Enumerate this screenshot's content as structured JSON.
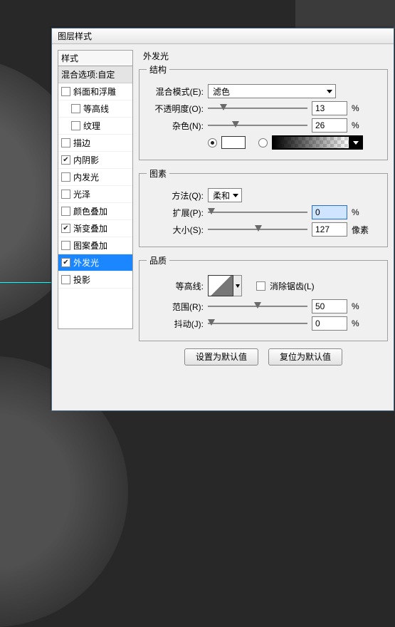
{
  "dialog": {
    "title": "图层样式"
  },
  "styles": {
    "header": "样式",
    "blend": "混合选项:自定",
    "items": [
      {
        "label": "斜面和浮雕",
        "checked": false,
        "indent": 0
      },
      {
        "label": "等高线",
        "checked": false,
        "indent": 1
      },
      {
        "label": "纹理",
        "checked": false,
        "indent": 1
      },
      {
        "label": "描边",
        "checked": false,
        "indent": 0
      },
      {
        "label": "内阴影",
        "checked": true,
        "indent": 0
      },
      {
        "label": "内发光",
        "checked": false,
        "indent": 0
      },
      {
        "label": "光泽",
        "checked": false,
        "indent": 0
      },
      {
        "label": "颜色叠加",
        "checked": false,
        "indent": 0
      },
      {
        "label": "渐变叠加",
        "checked": true,
        "indent": 0
      },
      {
        "label": "图案叠加",
        "checked": false,
        "indent": 0
      },
      {
        "label": "外发光",
        "checked": true,
        "indent": 0,
        "selected": true
      },
      {
        "label": "投影",
        "checked": false,
        "indent": 0
      }
    ]
  },
  "panel": {
    "title": "外发光",
    "struct": {
      "legend": "结构",
      "blend_label": "混合模式(E):",
      "blend_value": "滤色",
      "opacity_label": "不透明度(O):",
      "opacity_value": "13",
      "noise_label": "杂色(N):",
      "noise_value": "26",
      "percent": "%"
    },
    "elements": {
      "legend": "图素",
      "method_label": "方法(Q):",
      "method_value": "柔和",
      "spread_label": "扩展(P):",
      "spread_value": "0",
      "size_label": "大小(S):",
      "size_value": "127",
      "px": "像素",
      "percent": "%"
    },
    "quality": {
      "legend": "品质",
      "contour_label": "等高线:",
      "antialias_label": "消除锯齿(L)",
      "range_label": "范围(R):",
      "range_value": "50",
      "jitter_label": "抖动(J):",
      "jitter_value": "0",
      "percent": "%"
    },
    "buttons": {
      "default": "设置为默认值",
      "reset": "复位为默认值"
    }
  },
  "sliders": {
    "opacity_pct": 13,
    "noise_pct": 26,
    "spread_pct": 0,
    "size_pct": 51,
    "range_pct": 50,
    "jitter_pct": 0
  }
}
